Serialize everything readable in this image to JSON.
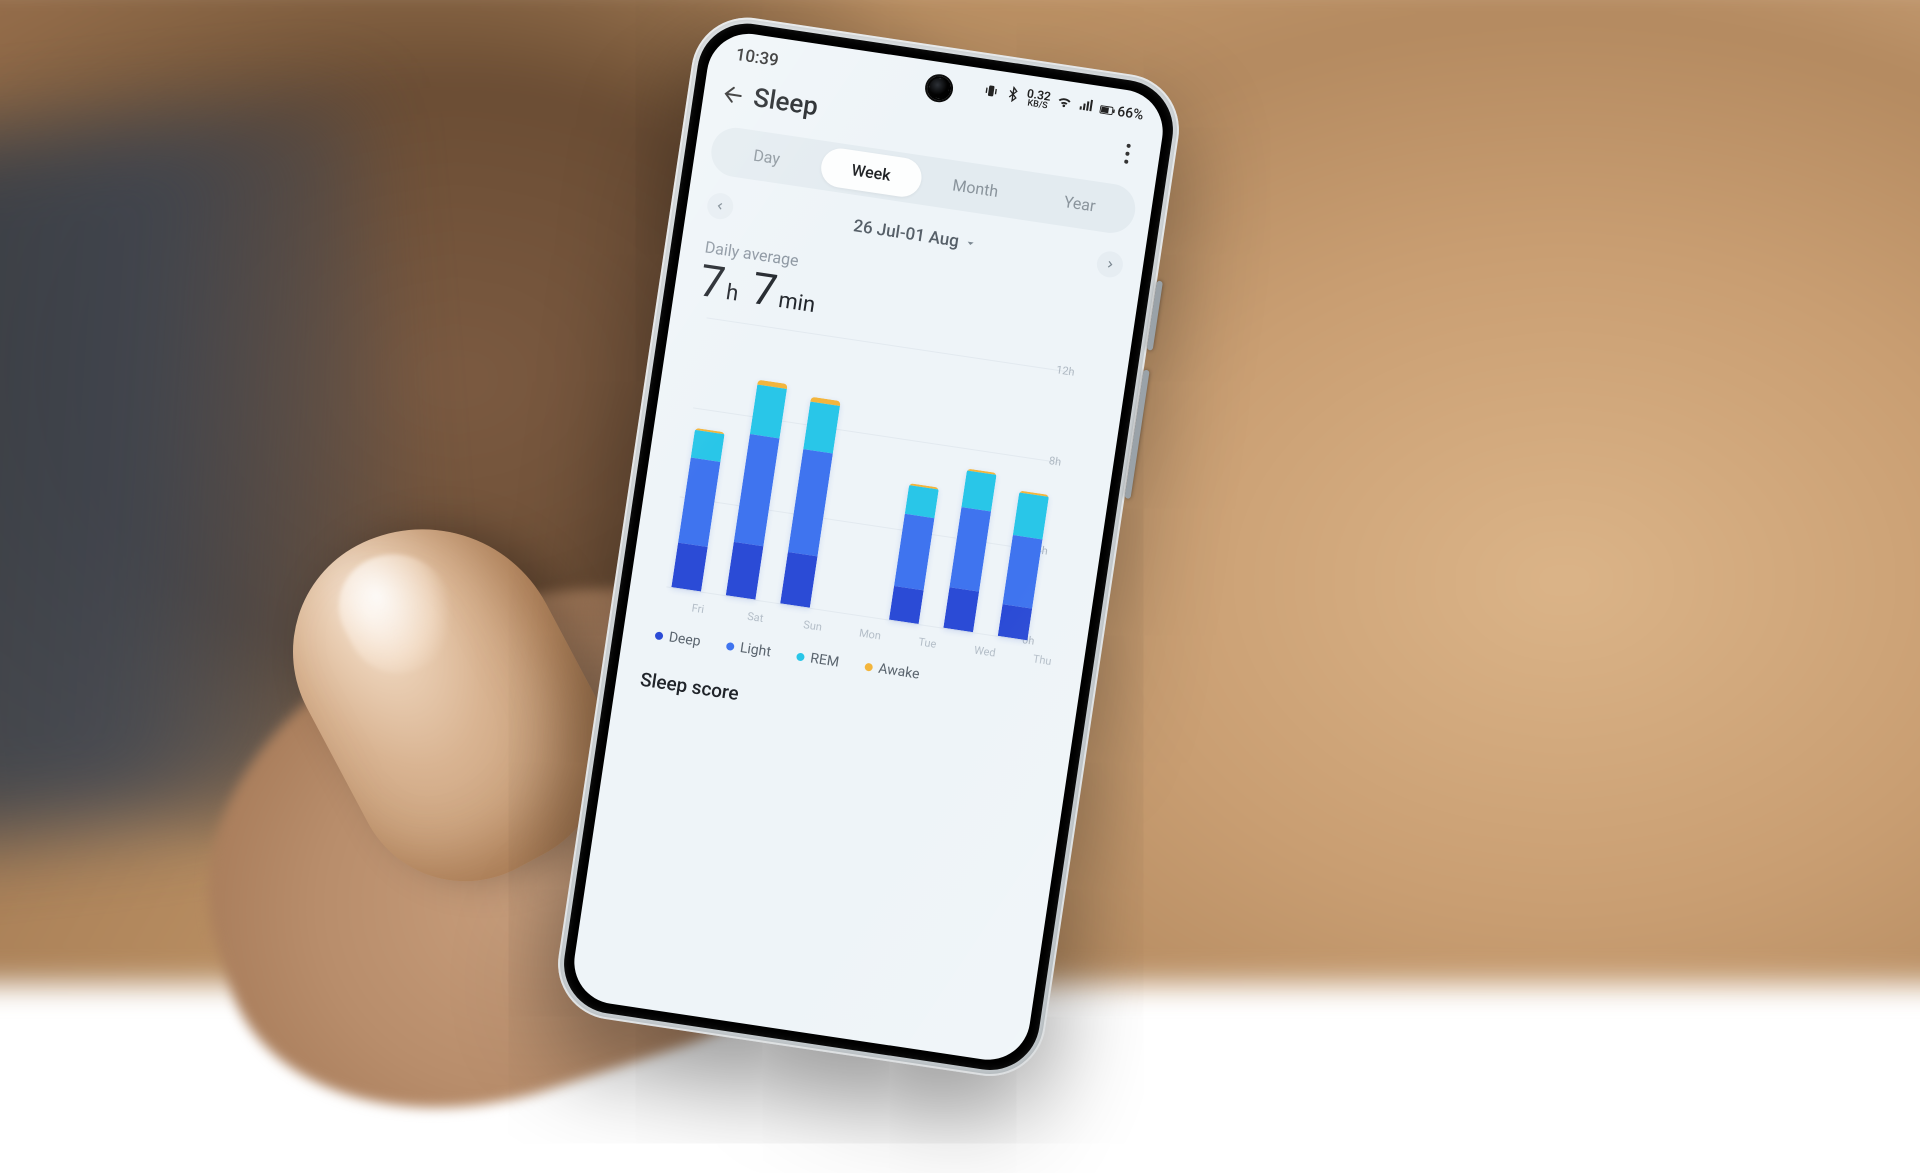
{
  "status_bar": {
    "time": "10:39",
    "net_rate_value": "0.32",
    "net_rate_unit": "KB/S",
    "battery": "66%"
  },
  "header": {
    "title": "Sleep"
  },
  "tabs": [
    {
      "label": "Day",
      "active": false
    },
    {
      "label": "Week",
      "active": true
    },
    {
      "label": "Month",
      "active": false
    },
    {
      "label": "Year",
      "active": false
    }
  ],
  "date_range": "26 Jul-01 Aug",
  "daily_average": {
    "label": "Daily average",
    "hours": "7",
    "hours_unit": "h",
    "minutes": "7",
    "minutes_unit": "min"
  },
  "chart_data": {
    "type": "bar",
    "stacked": true,
    "categories": [
      "Fri",
      "Sat",
      "Sun",
      "Mon",
      "Tue",
      "Wed",
      "Thu"
    ],
    "ylabel": "",
    "ylim": [
      0,
      12
    ],
    "yticks": [
      "12h",
      "8h",
      "4h",
      "0h"
    ],
    "series": [
      {
        "name": "Deep",
        "color": "#2b4bd6",
        "values": [
          2.0,
          2.4,
          2.3,
          0,
          1.5,
          1.8,
          1.4
        ]
      },
      {
        "name": "Light",
        "color": "#3f74ef",
        "values": [
          3.8,
          4.8,
          4.6,
          0,
          3.2,
          3.6,
          3.1
        ]
      },
      {
        "name": "REM",
        "color": "#29c6e8",
        "values": [
          1.2,
          2.2,
          2.1,
          0,
          1.3,
          1.6,
          1.9
        ]
      },
      {
        "name": "Awake",
        "color": "#f3b53c",
        "values": [
          0.1,
          0.2,
          0.2,
          0,
          0.1,
          0.1,
          0.1
        ]
      }
    ],
    "legend": [
      "Deep",
      "Light",
      "REM",
      "Awake"
    ]
  },
  "legend_colors": {
    "Deep": "#2b4bd6",
    "Light": "#3f74ef",
    "REM": "#29c6e8",
    "Awake": "#f3b53c"
  },
  "sleep_score_label": "Sleep score"
}
